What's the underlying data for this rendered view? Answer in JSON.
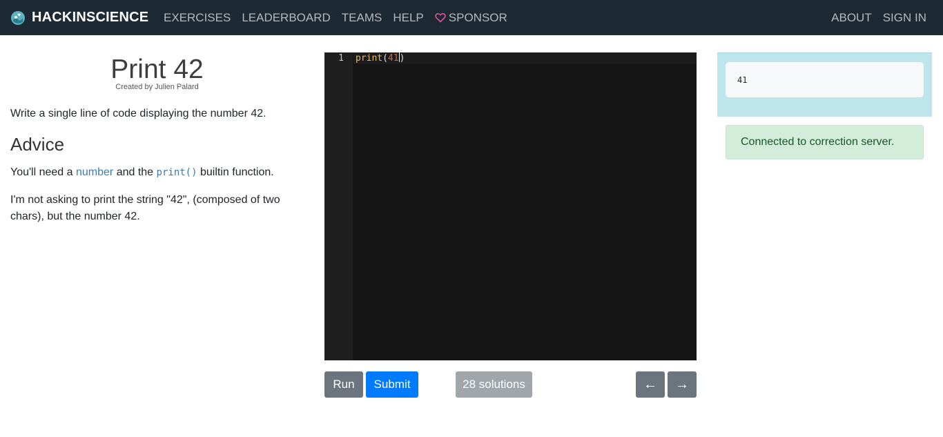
{
  "navbar": {
    "brand": "HACKINSCIENCE",
    "links": [
      "EXERCISES",
      "LEADERBOARD",
      "TEAMS",
      "HELP"
    ],
    "sponsor": "SPONSOR",
    "right_links": [
      "ABOUT",
      "SIGN IN"
    ],
    "background_color": "#1e2a33",
    "sponsor_heart_color": "#e84fa0"
  },
  "exercise": {
    "title": "Print 42",
    "author": "Created by Julien Palard",
    "description": "Write a single line of code displaying the number 42.",
    "advice_heading": "Advice",
    "advice_p1_a": "You'll need a ",
    "advice_p1_link": "number",
    "advice_p1_b": " and the ",
    "advice_p1_code": "print()",
    "advice_p1_c": " builtin function.",
    "advice_p2": "I'm not asking to print the string \"42\", (composed of two chars), but the number 42."
  },
  "editor": {
    "line_number": "1",
    "code_fn": "print",
    "code_open": "(",
    "code_arg": "41",
    "code_close": ")"
  },
  "buttons": {
    "run": "Run",
    "submit": "Submit",
    "solutions": "28 solutions",
    "prev": "←",
    "next": "→"
  },
  "output": {
    "value": "41",
    "status": "Connected to correction server."
  }
}
